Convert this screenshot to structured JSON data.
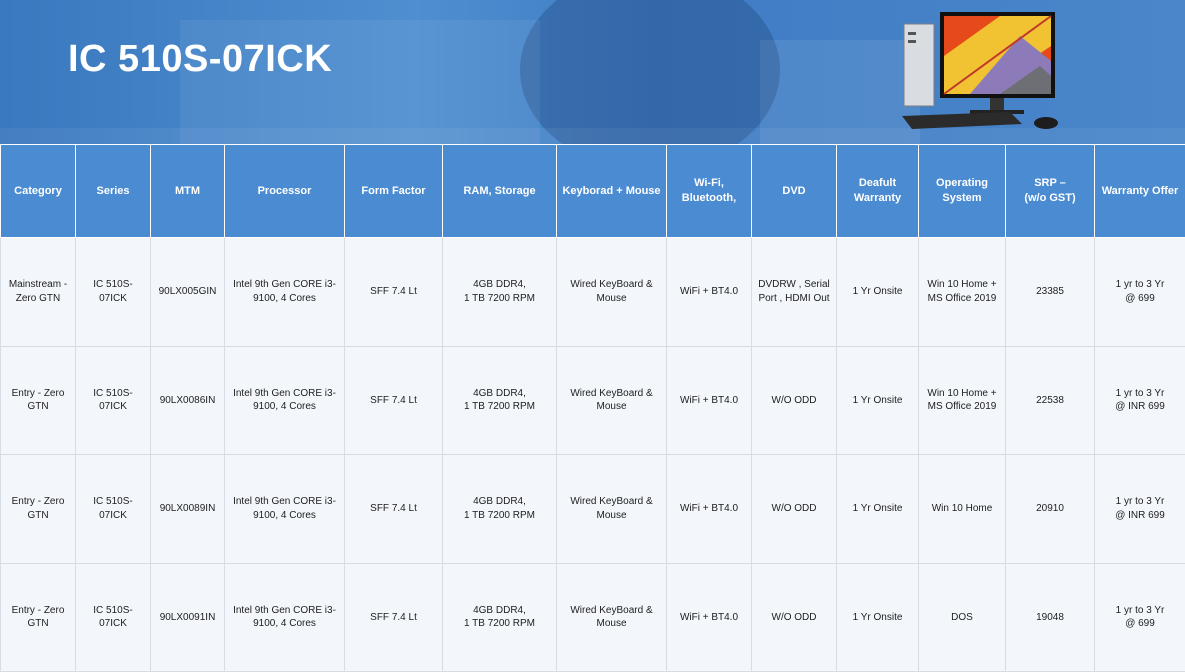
{
  "title": "IC 510S-07ICK",
  "columns": [
    "Category",
    "Series",
    "MTM",
    "Processor",
    "Form Factor",
    "RAM, Storage",
    "Keyborad + Mouse",
    "Wi-Fi,\nBluetooth,",
    "DVD",
    "Deafult\nWarranty",
    "Operating\nSystem",
    "SRP –\n(w/o GST)",
    "Warranty Offer"
  ],
  "rows": [
    [
      "Mainstream -\nZero GTN",
      "IC 510S-07ICK",
      "90LX005GIN",
      "Intel 9th Gen CORE i3-\n9100, 4 Cores",
      "SFF 7.4 Lt",
      "4GB DDR4,\n1 TB 7200 RPM",
      "Wired KeyBoard &\nMouse",
      "WiFi + BT4.0",
      "DVDRW ,  Serial\nPort ,  HDMI Out",
      "1 Yr Onsite",
      "Win 10 Home +\nMS Office 2019",
      "23385",
      "1 yr to 3 Yr\n@ 699"
    ],
    [
      "Entry - Zero\nGTN",
      "IC 510S-07ICK",
      "90LX0086IN",
      "Intel 9th Gen CORE i3-\n9100, 4 Cores",
      "SFF 7.4 Lt",
      "4GB DDR4,\n1 TB 7200 RPM",
      "Wired KeyBoard &\nMouse",
      "WiFi + BT4.0",
      "W/O ODD",
      "1 Yr Onsite",
      "Win 10 Home +\nMS Office 2019",
      "22538",
      "1 yr to 3 Yr\n@ INR 699"
    ],
    [
      "Entry - Zero\nGTN",
      "IC 510S-07ICK",
      "90LX0089IN",
      "Intel 9th Gen CORE i3-\n9100, 4 Cores",
      "SFF 7.4 Lt",
      "4GB DDR4,\n1 TB 7200 RPM",
      "Wired KeyBoard &\nMouse",
      "WiFi + BT4.0",
      "W/O ODD",
      "1 Yr Onsite",
      "Win 10 Home",
      "20910",
      "1 yr to 3 Yr\n@ INR 699"
    ],
    [
      "Entry - Zero\nGTN",
      "IC 510S-07ICK",
      "90LX0091IN",
      "Intel 9th Gen CORE i3-\n9100, 4 Cores",
      "SFF 7.4 Lt",
      "4GB DDR4,\n1 TB 7200 RPM",
      "Wired KeyBoard &\nMouse",
      "WiFi + BT4.0",
      "W/O ODD",
      "1 Yr Onsite",
      "DOS",
      "19048",
      "1 yr to 3 Yr\n@ 699"
    ]
  ],
  "colors": {
    "header_bg": "#4a8bd2",
    "banner_bg": "#3f7cc4",
    "cell_bg": "#f3f7fc"
  },
  "icons": {
    "product_image": "desktop-pc-icon"
  }
}
